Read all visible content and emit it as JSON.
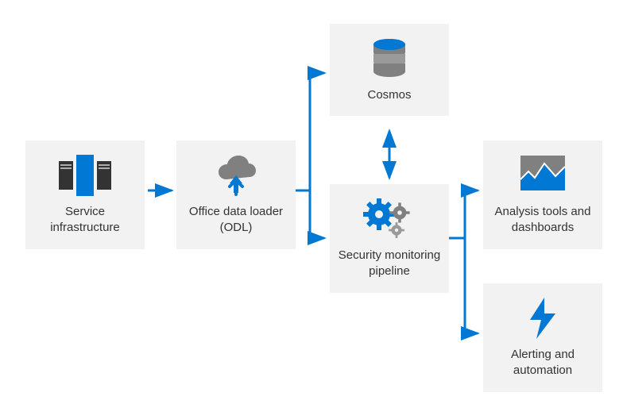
{
  "colors": {
    "accent": "#0078d4",
    "grey": "#808080",
    "box": "#f2f2f2"
  },
  "nodes": {
    "service_infra": {
      "label": "Service infrastructure"
    },
    "odl": {
      "label": "Office data loader (ODL)"
    },
    "cosmos": {
      "label": "Cosmos"
    },
    "security": {
      "label": "Security monitoring pipeline"
    },
    "analysis": {
      "label": "Analysis tools and dashboards"
    },
    "alerting": {
      "label": "Alerting and automation"
    }
  },
  "edges": [
    {
      "from": "service_infra",
      "to": "odl",
      "type": "arrow"
    },
    {
      "from": "odl",
      "to": "cosmos",
      "type": "arrow"
    },
    {
      "from": "odl",
      "to": "security",
      "type": "arrow"
    },
    {
      "from": "cosmos",
      "to": "security",
      "type": "double-arrow"
    },
    {
      "from": "security",
      "to": "analysis",
      "type": "arrow"
    },
    {
      "from": "security",
      "to": "alerting",
      "type": "arrow"
    }
  ]
}
